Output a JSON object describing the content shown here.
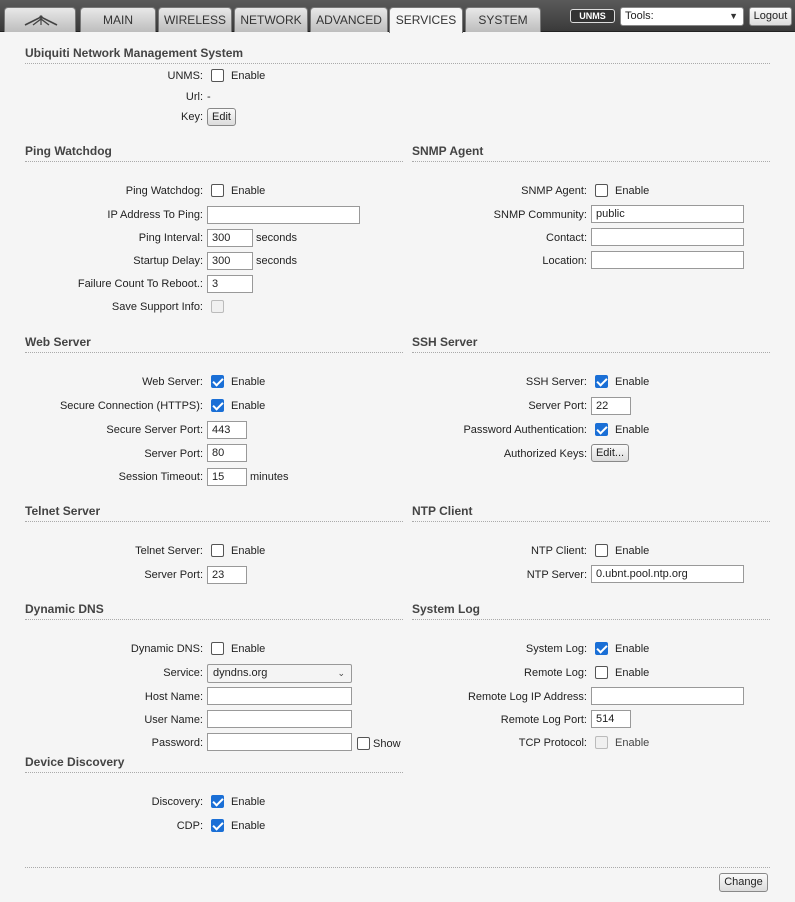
{
  "nav": {
    "tabs": [
      "MAIN",
      "WIRELESS",
      "NETWORK",
      "ADVANCED",
      "SERVICES",
      "SYSTEM"
    ],
    "active_tab": "SERVICES",
    "unms_badge": "UNMS",
    "tools": "Tools:",
    "logout": "Logout"
  },
  "unms": {
    "title": "Ubiquiti Network Management System",
    "unms_label": "UNMS:",
    "enable": "Enable",
    "url_label": "Url:",
    "url_value": "-",
    "key_label": "Key:",
    "edit": "Edit"
  },
  "ping": {
    "title": "Ping Watchdog",
    "watchdog_label": "Ping Watchdog:",
    "enable": "Enable",
    "ip_label": "IP Address To Ping:",
    "ip_value": "",
    "interval_label": "Ping Interval:",
    "interval_value": "300",
    "seconds": "seconds",
    "startup_label": "Startup Delay:",
    "startup_value": "300",
    "failure_label": "Failure Count To Reboot.:",
    "failure_value": "3",
    "support_label": "Save Support Info:"
  },
  "snmp": {
    "title": "SNMP Agent",
    "agent_label": "SNMP Agent:",
    "enable": "Enable",
    "community_label": "SNMP Community:",
    "community_value": "public",
    "contact_label": "Contact:",
    "contact_value": "",
    "location_label": "Location:",
    "location_value": ""
  },
  "web": {
    "title": "Web Server",
    "server_label": "Web Server:",
    "enable": "Enable",
    "https_label": "Secure Connection (HTTPS):",
    "secure_port_label": "Secure Server Port:",
    "secure_port_value": "443",
    "port_label": "Server Port:",
    "port_value": "80",
    "timeout_label": "Session Timeout:",
    "timeout_value": "15",
    "minutes": "minutes"
  },
  "ssh": {
    "title": "SSH Server",
    "server_label": "SSH Server:",
    "enable": "Enable",
    "port_label": "Server Port:",
    "port_value": "22",
    "pwauth_label": "Password Authentication:",
    "keys_label": "Authorized Keys:",
    "keys_button": "Edit..."
  },
  "telnet": {
    "title": "Telnet Server",
    "server_label": "Telnet Server:",
    "enable": "Enable",
    "port_label": "Server Port:",
    "port_value": "23"
  },
  "ntp": {
    "title": "NTP Client",
    "client_label": "NTP Client:",
    "enable": "Enable",
    "server_label": "NTP Server:",
    "server_value": "0.ubnt.pool.ntp.org"
  },
  "ddns": {
    "title": "Dynamic DNS",
    "ddns_label": "Dynamic DNS:",
    "enable": "Enable",
    "service_label": "Service:",
    "service_value": "dyndns.org",
    "host_label": "Host Name:",
    "host_value": "",
    "user_label": "User Name:",
    "user_value": "",
    "password_label": "Password:",
    "password_value": "",
    "show": "Show"
  },
  "syslog": {
    "title": "System Log",
    "log_label": "System Log:",
    "enable": "Enable",
    "remote_label": "Remote Log:",
    "remote_ip_label": "Remote Log IP Address:",
    "remote_ip_value": "",
    "remote_port_label": "Remote Log Port:",
    "remote_port_value": "514",
    "tcp_label": "TCP Protocol:"
  },
  "discovery": {
    "title": "Device Discovery",
    "discovery_label": "Discovery:",
    "enable": "Enable",
    "cdp_label": "CDP:"
  },
  "footer": {
    "change": "Change"
  }
}
